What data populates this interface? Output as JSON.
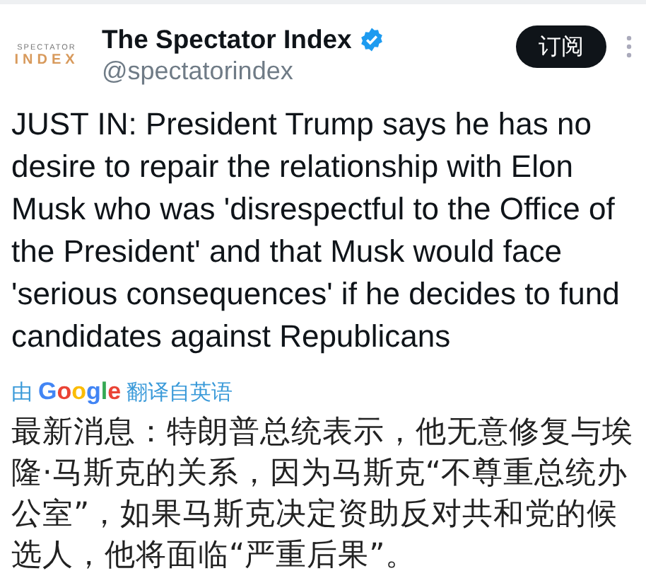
{
  "author": {
    "logo_top": "SPECTATOR",
    "logo_bottom": "INDEX",
    "name": "The Spectator Index",
    "verified": true,
    "handle": "@spectatorindex"
  },
  "subscribe_button": "订阅",
  "text": "JUST IN: President Trump says he has no desire to repair the relationship with Elon Musk who was 'disrespectful to the Office of the President' and that Musk would face 'serious consequences' if he decides to fund candidates against Republicans",
  "translation": {
    "by": "由",
    "provider": "Google",
    "label": "翻译自英语",
    "text": "最新消息：特朗普总统表示，他无意修复与埃隆·马斯克的关系，因为马斯克“不尊重总统办公室”，如果马斯克决定资助反对共和党的候选人，他将面临“严重后果”。"
  }
}
